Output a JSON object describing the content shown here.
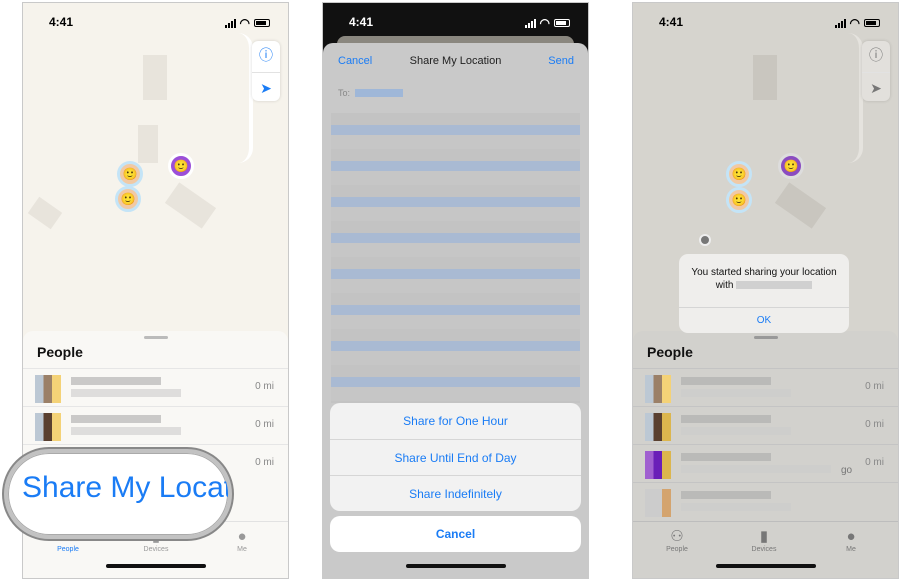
{
  "status": {
    "time": "4:41"
  },
  "left": {
    "people_title": "People",
    "rows": [
      {
        "distance": "0 mi"
      },
      {
        "distance": "0 mi"
      },
      {
        "distance": "0 mi"
      }
    ],
    "magnified_label": "Share My Locati",
    "tabs": [
      {
        "label": "People"
      },
      {
        "label": "Devices"
      },
      {
        "label": "Me"
      }
    ]
  },
  "middle": {
    "cancel": "Cancel",
    "title": "Share My Location",
    "send": "Send",
    "to_label": "To:",
    "actions": [
      "Share for One Hour",
      "Share Until End of Day",
      "Share Indefinitely"
    ],
    "cancel_action": "Cancel"
  },
  "right": {
    "alert_message": "You started sharing your location with",
    "alert_ok": "OK",
    "people_title": "People",
    "rows": [
      {
        "distance": "0 mi"
      },
      {
        "distance": "0 mi"
      },
      {
        "distance": "0 mi",
        "suffix": "go"
      }
    ],
    "tabs": [
      {
        "label": "People"
      },
      {
        "label": "Devices"
      },
      {
        "label": "Me"
      }
    ]
  },
  "colors": {
    "accent": "#1a7cf5",
    "map": "#f6f3ec"
  }
}
